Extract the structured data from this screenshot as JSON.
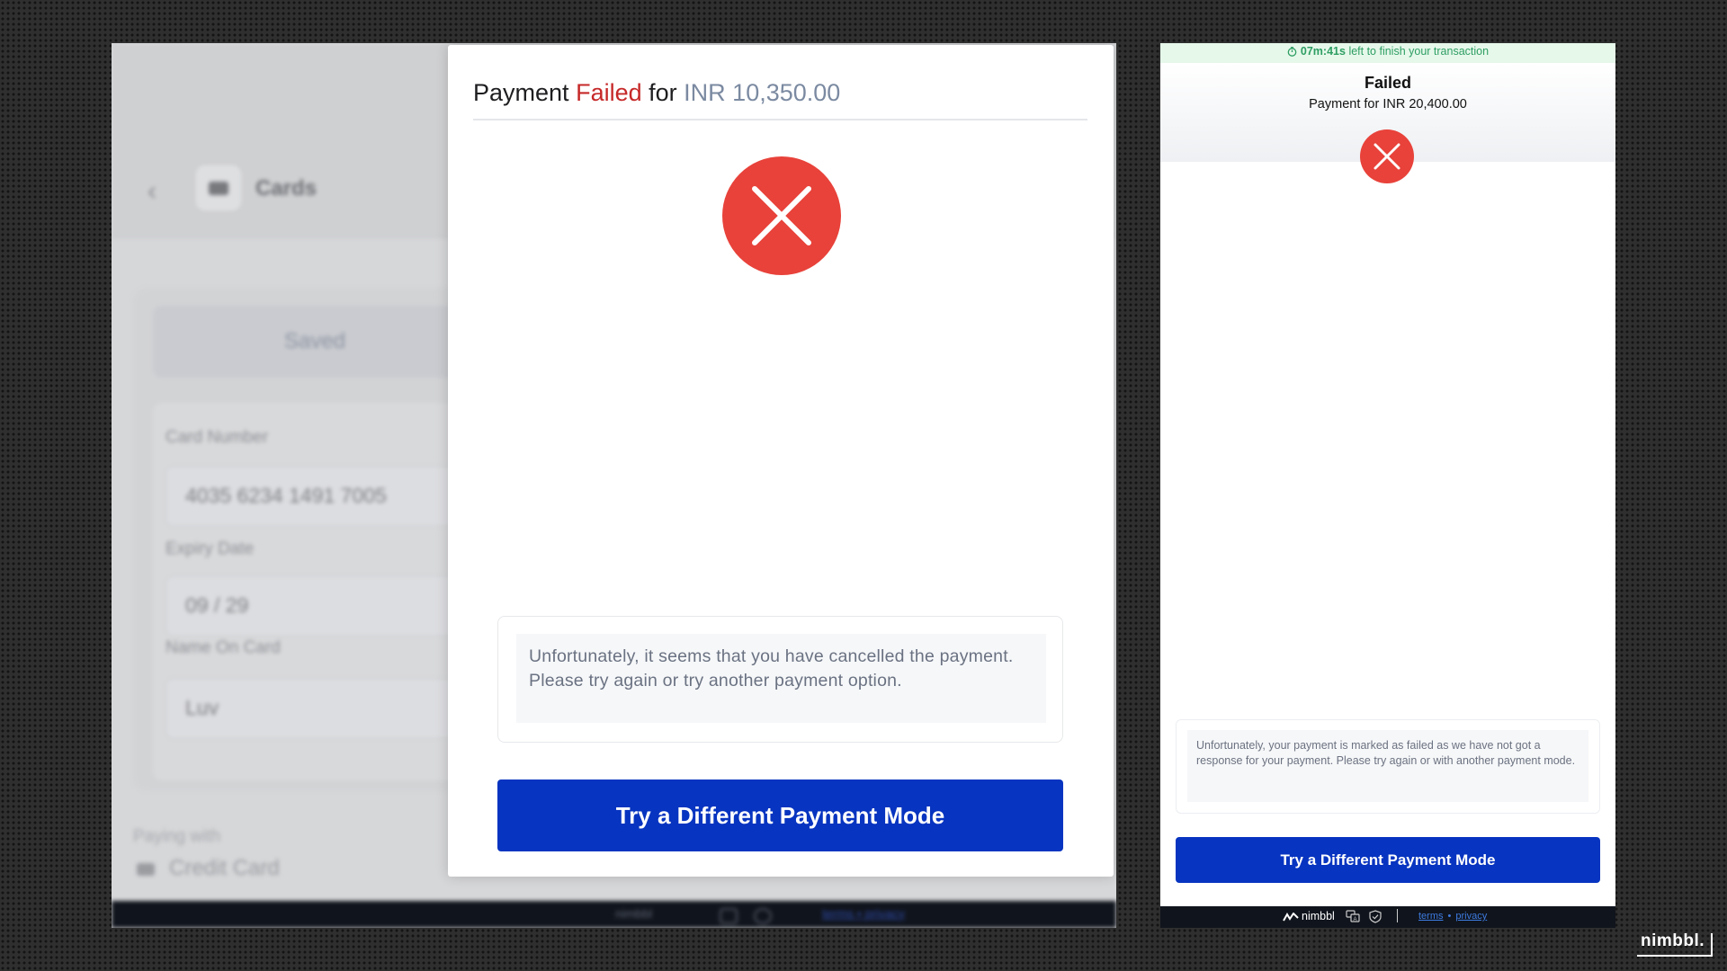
{
  "colors": {
    "accent_blue": "#0734c0",
    "failed_red": "#c62828",
    "error_icon_red": "#e8423a",
    "timer_green": "#2e9e63",
    "footer_dark": "#10141c"
  },
  "desktop_modal": {
    "title_prefix": "Payment",
    "title_status": "Failed",
    "title_middle": "for",
    "title_amount": "INR 10,350.00",
    "error_icon": "close-circle-icon",
    "message": "Unfortunately, it seems that you have cancelled the payment. Please try again or try another payment option.",
    "button_label": "Try a Different Payment Mode"
  },
  "desktop_background": {
    "section_title": "Cards",
    "tab_saved": "Saved",
    "card_number_label": "Card Number",
    "card_number_value": "4035 6234 1491 7005",
    "expiry_label": "Expiry Date",
    "expiry_value": "09 / 29",
    "name_label": "Name On Card",
    "name_value": "Luv",
    "paying_with_label": "Paying with",
    "paying_with_value": "Credit Card",
    "footer_brand": "nimbbl",
    "footer_terms": "terms",
    "footer_privacy": "privacy"
  },
  "mobile": {
    "timer_time": "07m:41s",
    "timer_text": "left to finish your transaction",
    "title": "Failed",
    "subtitle": "Payment for INR 20,400.00",
    "error_icon": "close-circle-icon",
    "message": "Unfortunately, your payment is marked as failed as we have not got a response for your payment. Please try again or with another payment mode.",
    "button_label": "Try a Different Payment Mode",
    "footer_brand": "nimbbl",
    "footer_terms": "terms",
    "footer_separator": "•",
    "footer_privacy": "privacy"
  },
  "brand_watermark": "nimbbl."
}
